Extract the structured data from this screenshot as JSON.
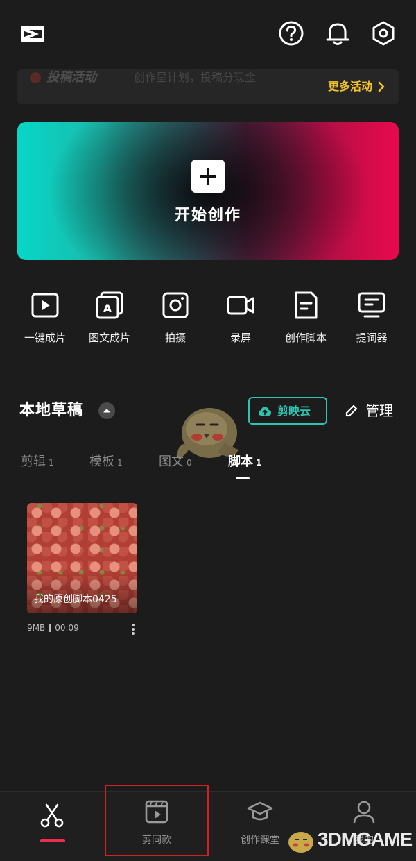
{
  "header": {
    "logo_icon": "capcut-logo-icon",
    "icons": [
      "help-icon",
      "bell-icon",
      "settings-icon"
    ]
  },
  "activity": {
    "title": "投稿活动",
    "subtitle": "创作星计划，投稿分现金",
    "more": "更多活动"
  },
  "start_card": {
    "label": "开始创作"
  },
  "tools": [
    {
      "label": "一键成片",
      "icon": "play-icon"
    },
    {
      "label": "图文成片",
      "icon": "image-text-icon"
    },
    {
      "label": "拍摄",
      "icon": "camera-icon"
    },
    {
      "label": "录屏",
      "icon": "screen-record-icon"
    },
    {
      "label": "创作脚本",
      "icon": "script-icon"
    },
    {
      "label": "提词器",
      "icon": "teleprompter-icon"
    }
  ],
  "drafts": {
    "title": "本地草稿",
    "cloud_label": "剪映云",
    "manage_label": "管理",
    "tabs": [
      {
        "label": "剪辑",
        "count": "1"
      },
      {
        "label": "模板",
        "count": "1"
      },
      {
        "label": "图文",
        "count": "0"
      },
      {
        "label": "脚本",
        "count": "1"
      }
    ],
    "active_tab": "脚本",
    "items": [
      {
        "name": "我的原创脚本0425",
        "size": "9MB",
        "duration": "00:09"
      }
    ]
  },
  "bottom_nav": [
    {
      "label": "",
      "icon": "scissors-icon"
    },
    {
      "label": "剪同款",
      "icon": "template-icon"
    },
    {
      "label": "创作课堂",
      "icon": "graduation-cap-icon"
    },
    {
      "label": "我的",
      "icon": "user-icon"
    }
  ],
  "watermark": {
    "text_num": "3DM",
    "text_word": "GAME"
  },
  "colors": {
    "accent_red": "#ee2d4e",
    "cloud_teal": "#2fc4b0",
    "activity_yellow": "#f2c12e",
    "background": "#1c1c1c"
  }
}
